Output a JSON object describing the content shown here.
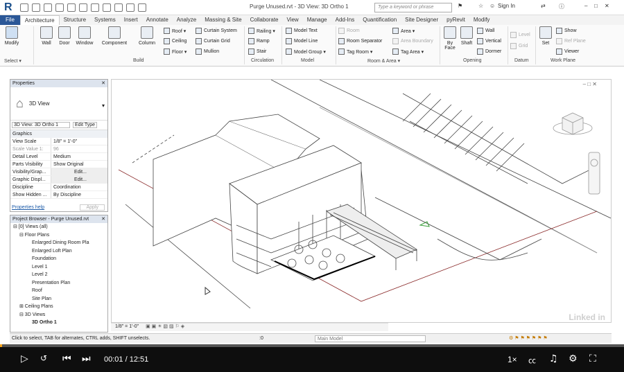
{
  "titlebar": {
    "app_logo": "R",
    "doc_title": "Purge Unused.rvt - 3D View: 3D Ortho 1",
    "search_placeholder": "Type a keyword or phrase",
    "sign_in": "Sign In"
  },
  "tabs": [
    "File",
    "Architecture",
    "Structure",
    "Systems",
    "Insert",
    "Annotate",
    "Analyze",
    "Massing & Site",
    "Collaborate",
    "View",
    "Manage",
    "Add-Ins",
    "Quantification",
    "Site Designer",
    "pyRevit",
    "Modify"
  ],
  "active_tab": "Architecture",
  "ribbon": {
    "select": {
      "modify": "Modify",
      "label": "Select ▾"
    },
    "build": {
      "wall": "Wall",
      "door": "Door",
      "window": "Window",
      "component": "Component",
      "column": "Column",
      "roof": "Roof ▾",
      "ceiling": "Ceiling",
      "floor": "Floor ▾",
      "curtain_system": "Curtain System",
      "curtain_grid": "Curtain Grid",
      "mullion": "Mullion",
      "label": "Build"
    },
    "circulation": {
      "railing": "Railing ▾",
      "ramp": "Ramp",
      "stair": "Stair",
      "label": "Circulation"
    },
    "model": {
      "text": "Model Text",
      "line": "Model Line",
      "group": "Model Group ▾",
      "label": "Model"
    },
    "room_area": {
      "room": "Room",
      "room_separator": "Room Separator",
      "tag_room": "Tag Room ▾",
      "area": "Area ▾",
      "area_boundary": "Area Boundary",
      "tag_area": "Tag Area ▾",
      "label": "Room & Area ▾"
    },
    "opening": {
      "by_face": "By Face",
      "shaft": "Shaft",
      "wall": "Wall",
      "vertical": "Vertical",
      "dormer": "Dormer",
      "label": "Opening"
    },
    "datum": {
      "level": "Level",
      "grid": "Grid",
      "label": "Datum"
    },
    "work_plane": {
      "set": "Set",
      "show": "Show",
      "ref_plane": "Ref Plane",
      "viewer": "Viewer",
      "label": "Work Plane"
    }
  },
  "properties": {
    "title": "Properties",
    "type_name": "3D View",
    "instance": "3D View: 3D Ortho 1",
    "edit_type": "Edit Type",
    "group": "Graphics",
    "rows": [
      {
        "k": "View Scale",
        "v": "1/8\" = 1'-0\""
      },
      {
        "k": "Scale Value    1:",
        "v": "96"
      },
      {
        "k": "Detail Level",
        "v": "Medium"
      },
      {
        "k": "Parts Visibility",
        "v": "Show Original"
      },
      {
        "k": "Visibility/Grap...",
        "v": "Edit..."
      },
      {
        "k": "Graphic Displ...",
        "v": "Edit..."
      },
      {
        "k": "Discipline",
        "v": "Coordination"
      },
      {
        "k": "Show Hidden ...",
        "v": "By Discipline"
      }
    ],
    "help": "Properties help",
    "apply": "Apply"
  },
  "browser": {
    "title": "Project Browser - Purge Unused.rvt",
    "items": [
      {
        "t": "⊟ [0] Views (all)",
        "i": 0
      },
      {
        "t": "⊟ Floor Plans",
        "i": 1
      },
      {
        "t": "Enlarged Dining Room Pla",
        "i": 3
      },
      {
        "t": "Enlarged Loft Plan",
        "i": 3
      },
      {
        "t": "Foundation",
        "i": 3
      },
      {
        "t": "Level 1",
        "i": 3
      },
      {
        "t": "Level 2",
        "i": 3
      },
      {
        "t": "Presentation Plan",
        "i": 3
      },
      {
        "t": "Roof",
        "i": 3
      },
      {
        "t": "Site Plan",
        "i": 3
      },
      {
        "t": "⊞ Ceiling Plans",
        "i": 1
      },
      {
        "t": "⊟ 3D Views",
        "i": 1
      },
      {
        "t": "3D Ortho 1",
        "i": 3
      }
    ]
  },
  "view_control": {
    "scale": "1/8\" = 1'-0\""
  },
  "status": {
    "hint": "Click to select, TAB for alternates, CTRL adds, SHIFT unselects.",
    "zero": ":0",
    "model": "Main Model"
  },
  "player": {
    "time": "00:01 / 12:51",
    "speed": "1×",
    "progress": 0.003,
    "watermark": "Linked in"
  },
  "colors": {
    "accent": "#f9a51a",
    "file_tab": "#2b5797",
    "player_bg": "#0e0e0e"
  }
}
